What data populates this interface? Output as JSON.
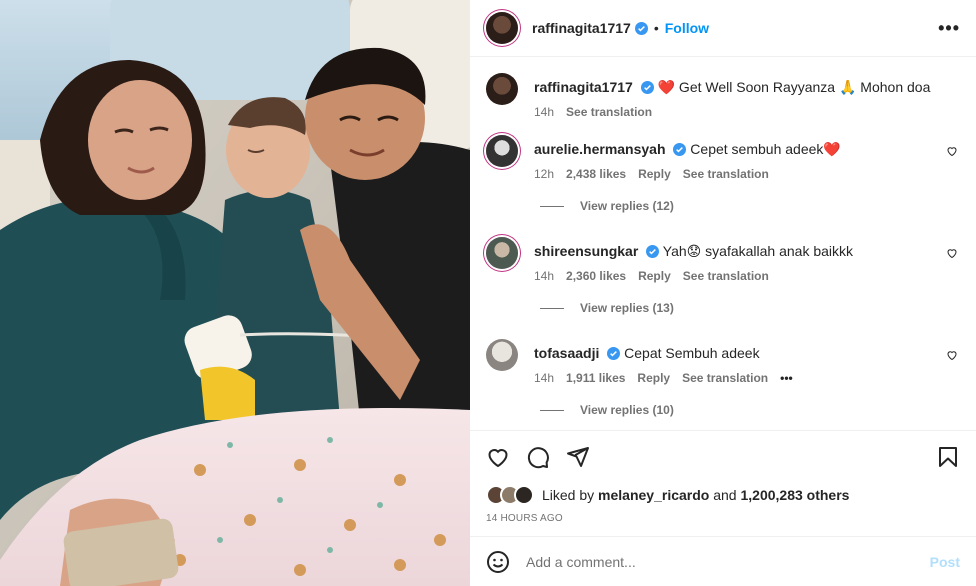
{
  "post": {
    "author": "raffinagita1717",
    "follow_label": "Follow",
    "dot": "•",
    "more_label": "•••",
    "caption": {
      "user": "raffinagita1717",
      "text": "❤️ Get Well Soon Rayyanza 🙏 Mohon doa",
      "time": "14h",
      "see_translation": "See translation"
    }
  },
  "comments": [
    {
      "user": "aurelie.hermansyah",
      "text": "Cepet sembuh adeek❤️",
      "time": "12h",
      "likes": "2,438 likes",
      "reply": "Reply",
      "see_translation": "See translation",
      "view_replies": "View replies (12)"
    },
    {
      "user": "shireensungkar",
      "text": "Yah😟 syafakallah anak baikkk",
      "time": "14h",
      "likes": "2,360 likes",
      "reply": "Reply",
      "see_translation": "See translation",
      "view_replies": "View replies (13)"
    },
    {
      "user": "tofasaadji",
      "text": "Cepat Sembuh adeek",
      "time": "14h",
      "likes": "1,911 likes",
      "reply": "Reply",
      "see_translation": "See translation",
      "more": "•••",
      "view_replies": "View replies (10)"
    }
  ],
  "likes": {
    "prefix": "Liked by",
    "user": "melaney_ricardo",
    "and": "and",
    "others": "1,200,283 others"
  },
  "time_ago": "14 HOURS AGO",
  "composer": {
    "placeholder": "Add a comment...",
    "post_label": "Post"
  },
  "colors": {
    "accent": "#0095f6",
    "verified": "#3897f0",
    "muted": "#737373",
    "post_disabled": "#b2dffc"
  },
  "icons": [
    "heart-icon",
    "comment-icon",
    "share-icon",
    "bookmark-icon",
    "emoji-icon",
    "verified-icon",
    "more-icon"
  ]
}
